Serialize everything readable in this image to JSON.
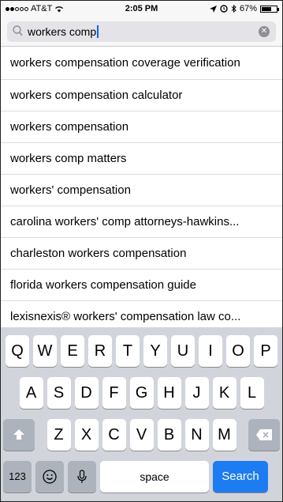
{
  "status_bar": {
    "carrier": "AT&T",
    "time": "2:05 PM",
    "battery": "67%",
    "battery_level": 0.67
  },
  "search": {
    "query": "workers comp",
    "clear_icon": "clear-circle-icon",
    "search_icon": "magnifier-icon"
  },
  "suggestions": [
    "workers compensation coverage verification",
    "workers compensation calculator",
    "workers compensation",
    "workers comp matters",
    "workers' compensation",
    "carolina workers' comp attorneys-hawkins...",
    "charleston workers compensation",
    "florida workers compensation guide",
    "lexisnexis® workers' compensation law co..."
  ],
  "keyboard": {
    "row1": [
      "Q",
      "W",
      "E",
      "R",
      "T",
      "Y",
      "U",
      "I",
      "O",
      "P"
    ],
    "row2": [
      "A",
      "S",
      "D",
      "F",
      "G",
      "H",
      "J",
      "K",
      "L"
    ],
    "row3": [
      "Z",
      "X",
      "C",
      "V",
      "B",
      "N",
      "M"
    ],
    "numbers_label": "123",
    "space_label": "space",
    "search_label": "Search",
    "accent_color": "#1e7cf2"
  }
}
